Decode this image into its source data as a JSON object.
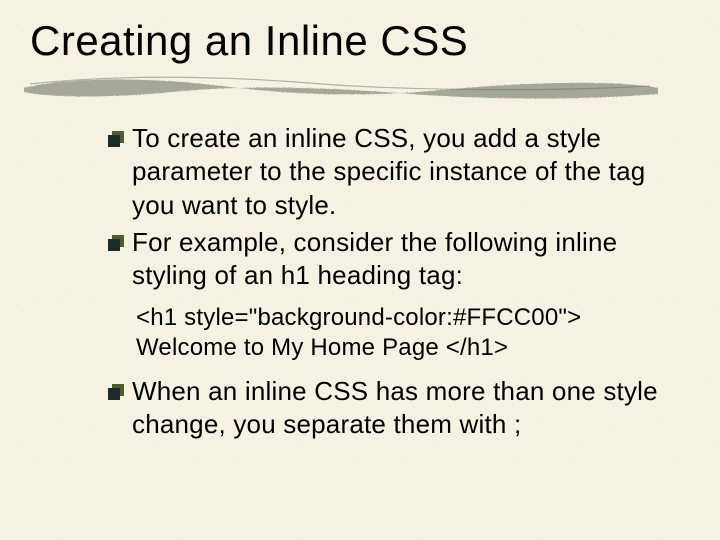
{
  "title": "Creating an Inline CSS",
  "bullets": [
    "To create an inline CSS, you add a style parameter to the specific instance of the tag you want to style.",
    "For example, consider the following inline styling of an h1 heading tag:"
  ],
  "code": {
    "line1": "<h1 style=\"background-color:#FFCC00\">",
    "line2": "Welcome to My Home Page </h1>"
  },
  "bullet3": "When an inline CSS has more than one style change, you separate them with ;",
  "colors": {
    "bg": "#f5f2e3",
    "brush": "#8c8f84",
    "bulletDark": "#1d2a2a",
    "bulletOlive": "#4f5a2f"
  }
}
